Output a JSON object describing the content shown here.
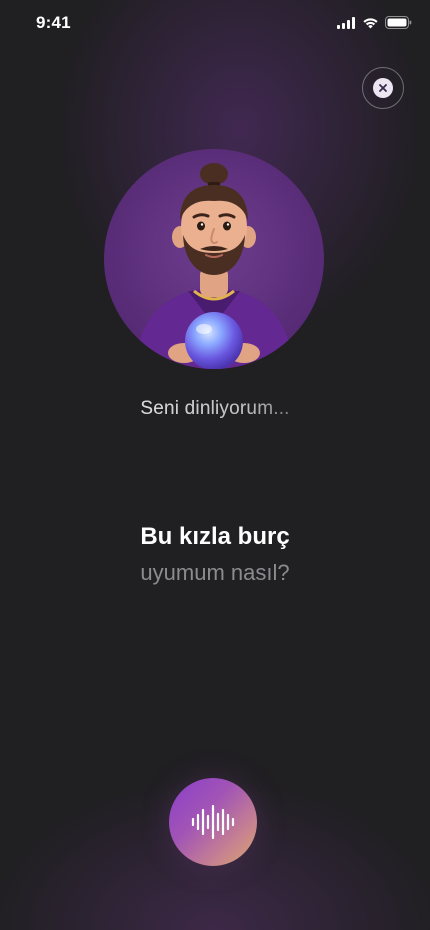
{
  "status_bar": {
    "time": "9:41"
  },
  "close_button": {
    "icon": "close-icon"
  },
  "avatar": {
    "icon": "astrologer-avatar"
  },
  "listening": {
    "text": "Seni dinliyorum..."
  },
  "question": {
    "line1": "Bu kızla burç",
    "line2": "uyumum nasıl?"
  },
  "voice_button": {
    "icon": "sound-wave-icon"
  },
  "colors": {
    "background": "#201f22",
    "accent_start": "#8a3ec9",
    "accent_end": "#d9a86a",
    "avatar_bg": "#5a2d79",
    "muted_text": "#8c8b90"
  }
}
